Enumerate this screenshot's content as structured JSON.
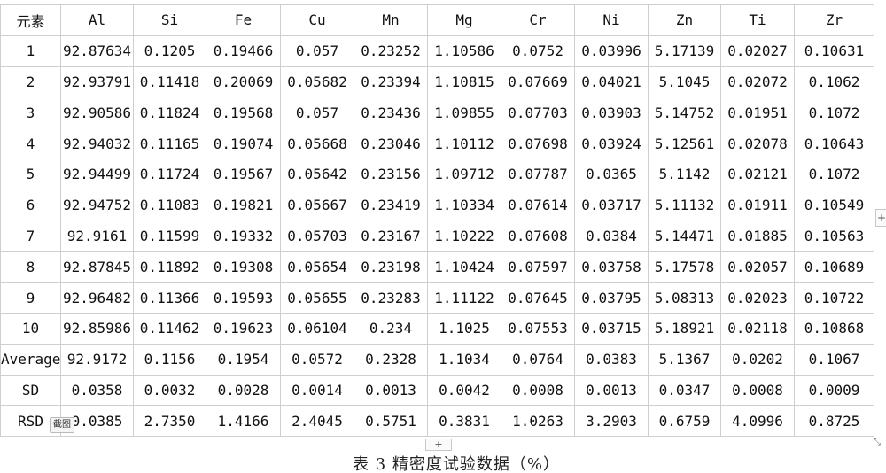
{
  "table": {
    "header": [
      "元素",
      "Al",
      "Si",
      "Fe",
      "Cu",
      "Mn",
      "Mg",
      "Cr",
      "Ni",
      "Zn",
      "Ti",
      "Zr"
    ],
    "rows": [
      [
        "1",
        "92.87634",
        "0.1205",
        "0.19466",
        "0.057",
        "0.23252",
        "1.10586",
        "0.0752",
        "0.03996",
        "5.17139",
        "0.02027",
        "0.10631"
      ],
      [
        "2",
        "92.93791",
        "0.11418",
        "0.20069",
        "0.05682",
        "0.23394",
        "1.10815",
        "0.07669",
        "0.04021",
        "5.1045",
        "0.02072",
        "0.1062"
      ],
      [
        "3",
        "92.90586",
        "0.11824",
        "0.19568",
        "0.057",
        "0.23436",
        "1.09855",
        "0.07703",
        "0.03903",
        "5.14752",
        "0.01951",
        "0.1072"
      ],
      [
        "4",
        "92.94032",
        "0.11165",
        "0.19074",
        "0.05668",
        "0.23046",
        "1.10112",
        "0.07698",
        "0.03924",
        "5.12561",
        "0.02078",
        "0.10643"
      ],
      [
        "5",
        "92.94499",
        "0.11724",
        "0.19567",
        "0.05642",
        "0.23156",
        "1.09712",
        "0.07787",
        "0.0365",
        "5.1142",
        "0.02121",
        "0.1072"
      ],
      [
        "6",
        "92.94752",
        "0.11083",
        "0.19821",
        "0.05667",
        "0.23419",
        "1.10334",
        "0.07614",
        "0.03717",
        "5.11132",
        "0.01911",
        "0.10549"
      ],
      [
        "7",
        "92.9161",
        "0.11599",
        "0.19332",
        "0.05703",
        "0.23167",
        "1.10222",
        "0.07608",
        "0.0384",
        "5.14471",
        "0.01885",
        "0.10563"
      ],
      [
        "8",
        "92.87845",
        "0.11892",
        "0.19308",
        "0.05654",
        "0.23198",
        "1.10424",
        "0.07597",
        "0.03758",
        "5.17578",
        "0.02057",
        "0.10689"
      ],
      [
        "9",
        "92.96482",
        "0.11366",
        "0.19593",
        "0.05655",
        "0.23283",
        "1.11122",
        "0.07645",
        "0.03795",
        "5.08313",
        "0.02023",
        "0.10722"
      ],
      [
        "10",
        "92.85986",
        "0.11462",
        "0.19623",
        "0.06104",
        "0.234",
        "1.1025",
        "0.07553",
        "0.03715",
        "5.18921",
        "0.02118",
        "0.10868"
      ],
      [
        "Average",
        "92.9172",
        "0.1156",
        "0.1954",
        "0.0572",
        "0.2328",
        "1.1034",
        "0.0764",
        "0.0383",
        "5.1367",
        "0.0202",
        "0.1067"
      ],
      [
        "SD",
        "0.0358",
        "0.0032",
        "0.0028",
        "0.0014",
        "0.0013",
        "0.0042",
        "0.0008",
        "0.0013",
        "0.0347",
        "0.0008",
        "0.0009"
      ],
      [
        "RSD",
        "0.0385",
        "2.7350",
        "1.4166",
        "2.4045",
        "0.5751",
        "0.3831",
        "1.0263",
        "3.2903",
        "0.6759",
        "4.0996",
        "0.8725"
      ]
    ]
  },
  "caption": "表 3 精密度试验数据（%）",
  "controls": {
    "row_add": "+",
    "col_add": "+",
    "resize": "⤡"
  },
  "tooltip": "截图"
}
